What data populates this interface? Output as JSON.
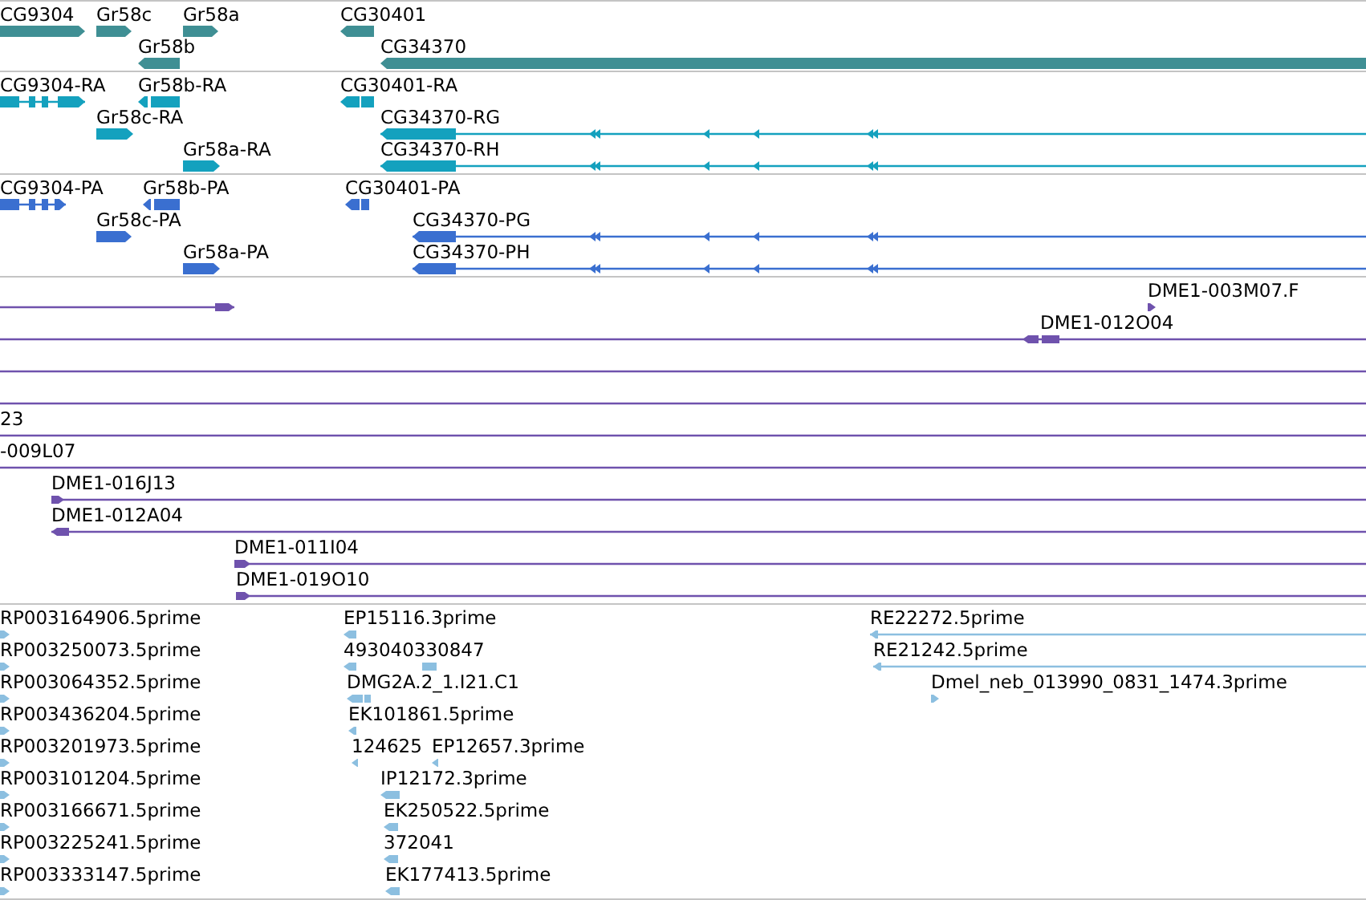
{
  "tracks": [
    {
      "color": "#3f8f94",
      "rows": [
        {
          "features": [
            {
              "label": "CG9304",
              "forward": true
            },
            {
              "label": "Gr58c",
              "forward": true
            },
            {
              "label": "Gr58a",
              "forward": true
            },
            {
              "label": "CG30401",
              "forward": false
            }
          ]
        },
        {
          "features": [
            {
              "label": "Gr58b",
              "forward": false
            },
            {
              "label": "CG34370",
              "forward": false
            }
          ]
        }
      ]
    },
    {
      "color": "#14a1be",
      "rows": [
        {
          "features": [
            {
              "label": "CG9304-RA",
              "forward": true
            },
            {
              "label": "Gr58b-RA",
              "forward": false
            },
            {
              "label": "CG30401-RA",
              "forward": false
            }
          ]
        },
        {
          "features": [
            {
              "label": "Gr58c-RA",
              "forward": true
            },
            {
              "label": "CG34370-RG",
              "forward": false
            }
          ]
        },
        {
          "features": [
            {
              "label": "Gr58a-RA",
              "forward": true
            },
            {
              "label": "CG34370-RH",
              "forward": false
            }
          ]
        }
      ]
    },
    {
      "color": "#3a6fd0",
      "rows": [
        {
          "features": [
            {
              "label": "CG9304-PA",
              "forward": true
            },
            {
              "label": "Gr58b-PA",
              "forward": false
            },
            {
              "label": "CG30401-PA",
              "forward": false
            }
          ]
        },
        {
          "features": [
            {
              "label": "Gr58c-PA",
              "forward": true
            },
            {
              "label": "CG34370-PG",
              "forward": false
            }
          ]
        },
        {
          "features": [
            {
              "label": "Gr58a-PA",
              "forward": true
            },
            {
              "label": "CG34370-PH",
              "forward": false
            }
          ]
        }
      ]
    },
    {
      "color": "#6f52ad",
      "rows": [
        {
          "kind": "features",
          "features": [
            {
              "forward": true
            },
            {
              "label": "DME1-003M07.F",
              "forward": true
            }
          ]
        },
        {
          "kind": "features",
          "features": [
            {
              "label": "DME1-012O04",
              "forward": false
            }
          ]
        },
        {
          "kind": "line"
        },
        {
          "kind": "line"
        },
        {
          "kind": "features",
          "features": [
            {
              "label": "23"
            }
          ]
        },
        {
          "kind": "features",
          "features": [
            {
              "label": "-009L07"
            }
          ]
        },
        {
          "kind": "features",
          "features": [
            {
              "label": "DME1-016J13",
              "forward": true
            }
          ]
        },
        {
          "kind": "features",
          "features": [
            {
              "label": "DME1-012A04",
              "forward": false
            }
          ]
        },
        {
          "kind": "features",
          "features": [
            {
              "label": "DME1-011I04",
              "forward": true
            }
          ]
        },
        {
          "kind": "features",
          "features": [
            {
              "label": "DME1-019O10",
              "forward": true
            }
          ]
        }
      ]
    },
    {
      "color": "#8cbfe0",
      "rows": [
        {
          "features": [
            {
              "label": "RP003164906.5prime",
              "forward": true
            },
            {
              "label": "EP15116.3prime",
              "forward": false
            },
            {
              "label": "RE22272.5prime",
              "forward": false
            }
          ]
        },
        {
          "features": [
            {
              "label": "RP003250073.5prime",
              "forward": true
            },
            {
              "label": "493040330847",
              "forward": false
            },
            {
              "label": "RE21242.5prime",
              "forward": false
            }
          ]
        },
        {
          "features": [
            {
              "label": "RP003064352.5prime",
              "forward": true
            },
            {
              "label": "DMG2A.2_1.I21.C1",
              "forward": false
            },
            {
              "label": "Dmel_neb_013990_0831_1474.3prime",
              "forward": true
            }
          ]
        },
        {
          "features": [
            {
              "label": "RP003436204.5prime",
              "forward": true
            },
            {
              "label": "EK101861.5prime",
              "forward": false
            }
          ]
        },
        {
          "features": [
            {
              "label": "RP003201973.5prime",
              "forward": true
            },
            {
              "label": "124625",
              "forward": false
            },
            {
              "label": "EP12657.3prime",
              "forward": false
            }
          ]
        },
        {
          "features": [
            {
              "label": "RP003101204.5prime",
              "forward": true
            },
            {
              "label": "IP12172.3prime",
              "forward": false
            }
          ]
        },
        {
          "features": [
            {
              "label": "RP003166671.5prime",
              "forward": true
            },
            {
              "label": "EK250522.5prime",
              "forward": false
            }
          ]
        },
        {
          "features": [
            {
              "label": "RP003225241.5prime",
              "forward": true
            },
            {
              "label": "372041",
              "forward": false
            }
          ]
        },
        {
          "features": [
            {
              "label": "RP003333147.5prime",
              "forward": true
            },
            {
              "label": "EK177413.5prime",
              "forward": false
            }
          ]
        }
      ]
    }
  ]
}
